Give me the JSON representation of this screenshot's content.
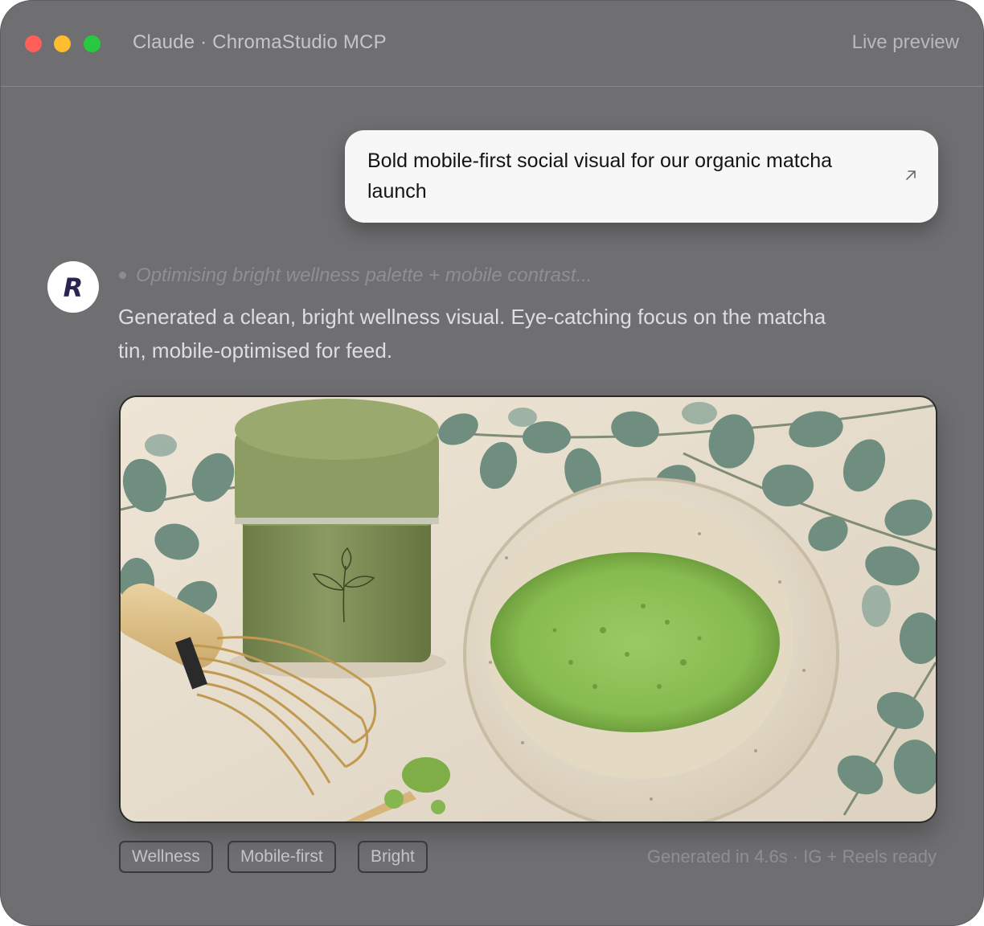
{
  "window": {
    "title": "Claude · ChromaStudio MCP",
    "right_label": "Live preview"
  },
  "prompt": {
    "text": "Bold mobile-first social visual for our organic matcha launch",
    "icon": "arrow-up-right-icon"
  },
  "assistant": {
    "avatar_letter": "R",
    "status": "Optimising bright wellness palette + mobile contrast...",
    "message": "Generated a clean, bright wellness visual. Eye-catching focus on the matcha tin, mobile-optimised for feed."
  },
  "tags": [
    "Wellness",
    "Mobile-first",
    "Bright"
  ],
  "footer": {
    "info": "Generated in 4.6s · IG + Reels ready"
  },
  "colors": {
    "window_bg": "#6f6f71",
    "bubble_bg": "#f7f7f7",
    "matcha_green": "#8fbf5a",
    "tin_green": "#7e8f57",
    "avatar_letter": "#2b2350"
  }
}
